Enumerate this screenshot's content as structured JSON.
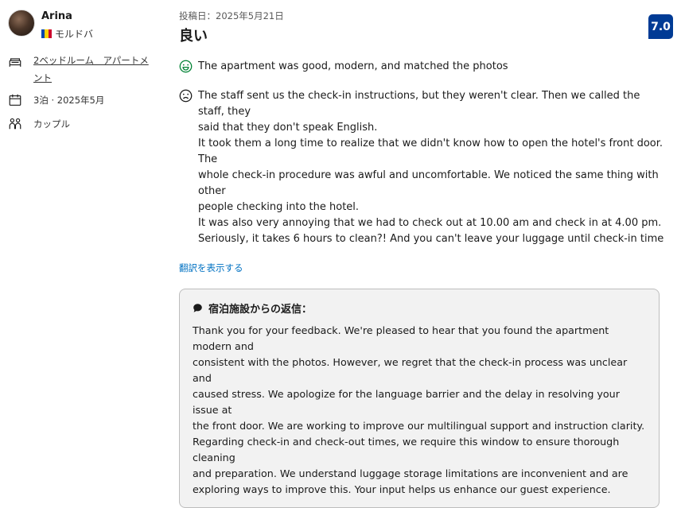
{
  "reviewer": {
    "name": "Arina",
    "country": "モルドバ",
    "flag_colors": [
      "#0046ae",
      "#ffd200",
      "#cc092f"
    ]
  },
  "stay": {
    "room_label": "2ベッドルーム アパートメント",
    "room_line1": "2ベッドルーム　アパートメ",
    "room_line2": "ント",
    "nights_date": "3泊 · 2025年5月",
    "traveler_type": "カップル"
  },
  "review": {
    "posted_date": "投稿日：2025年5月21日",
    "title": "良い",
    "score": "7.0",
    "positive_text": "The apartment was good, modern, and matched the photos",
    "negative_lines": [
      "The staff sent us the check-in instructions, but they weren't clear. Then we called the staff, they",
      "said that they don't speak English.",
      "It took them a long time to realize that we didn't know how to open the hotel's front door. The",
      "whole check-in procedure was awful and uncomfortable. We noticed the same thing with other",
      "people checking into the hotel.",
      "It was also very annoying that we had to check out at 10.00 am and check in at 4.00 pm.",
      "Seriously, it takes 6 hours to clean?! And you can't leave your luggage until check-in time"
    ],
    "translate_link": "翻訳を表示する"
  },
  "property_reply": {
    "heading": "宿泊施設からの返信：",
    "lines": [
      "Thank you for your feedback. We're pleased to hear that you found the apartment modern and",
      "consistent with the photos. However, we regret that the check-in process was unclear and",
      "caused stress. We apologize for the language barrier and the delay in resolving your issue at",
      "the front door. We are working to improve our multilingual support and instruction clarity.",
      "Regarding check-in and check-out times, we require this window to ensure thorough cleaning",
      "and preparation. We understand luggage storage limitations are inconvenient and are",
      "exploring ways to improve this. Your input helps us enhance our guest experience."
    ]
  },
  "colors": {
    "score_badge": "#003b95",
    "link": "#0071c2",
    "positive_icon": "#008234",
    "reply_background": "#f2f2f2"
  }
}
